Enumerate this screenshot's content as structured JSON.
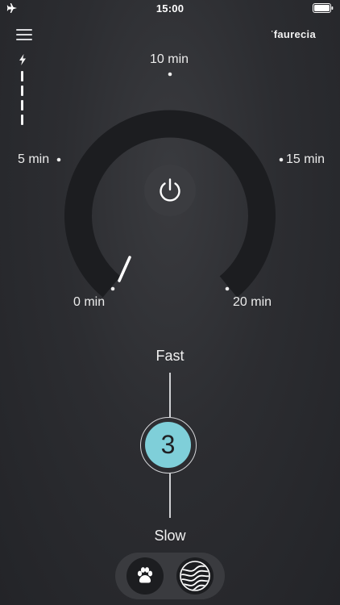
{
  "status_bar": {
    "time": "15:00",
    "left_icon": "airplane-icon",
    "right_icon": "battery-icon"
  },
  "header": {
    "menu_icon": "hamburger-icon",
    "brand": "faurecia"
  },
  "power_level": {
    "icon": "bolt-icon",
    "bars": 4
  },
  "timer_dial": {
    "labels": {
      "min0": "0 min",
      "min5": "5 min",
      "min10": "10 min",
      "min15": "15 min",
      "min20": "20 min"
    },
    "range_minutes": [
      0,
      20
    ],
    "current_minutes": 0,
    "center_icon": "power-icon"
  },
  "speed_control": {
    "top_label": "Fast",
    "bottom_label": "Slow",
    "value": "3"
  },
  "modes": [
    {
      "name": "pet",
      "icon": "paw-icon"
    },
    {
      "name": "wave",
      "icon": "wave-icon"
    }
  ],
  "colors": {
    "accent": "#7fcfd9",
    "ring": "#1c1d20",
    "background": "#2c2d31"
  }
}
